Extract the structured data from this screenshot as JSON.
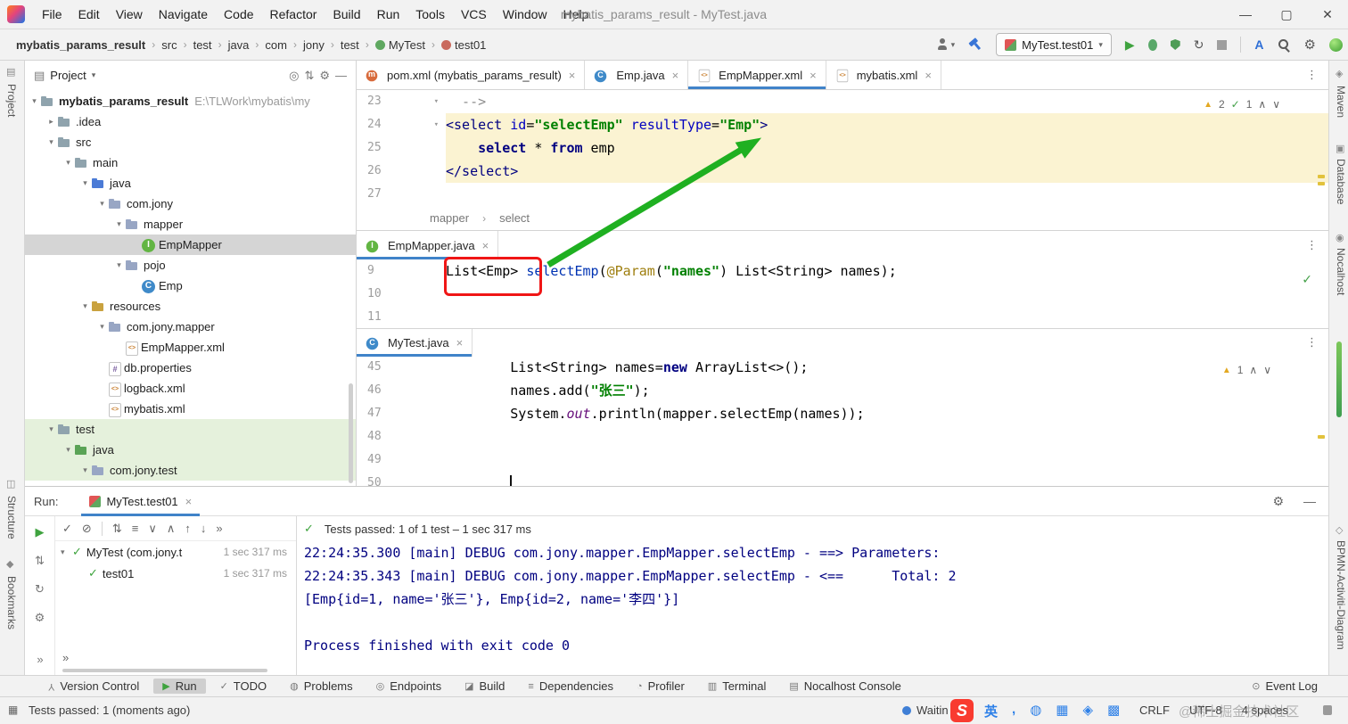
{
  "window": {
    "title": "mybatis_params_result - MyTest.java"
  },
  "menubar": [
    "File",
    "Edit",
    "View",
    "Navigate",
    "Code",
    "Refactor",
    "Build",
    "Run",
    "Tools",
    "VCS",
    "Window",
    "Help"
  ],
  "navbar": {
    "breadcrumbs": [
      {
        "label": "mybatis_params_result",
        "bold": true
      },
      {
        "label": "src"
      },
      {
        "label": "test"
      },
      {
        "label": "java"
      },
      {
        "label": "com"
      },
      {
        "label": "jony"
      },
      {
        "label": "test"
      },
      {
        "label": "MyTest",
        "icon": "test-class"
      },
      {
        "label": "test01",
        "icon": "test-method"
      }
    ],
    "run_config": "MyTest.test01"
  },
  "left_strip": {
    "items": [
      {
        "label": "Project"
      },
      {
        "label": "Structure"
      },
      {
        "label": "Bookmarks"
      }
    ]
  },
  "right_strip": {
    "items": [
      {
        "label": "Maven"
      },
      {
        "label": "Database"
      },
      {
        "label": "Nocalhost"
      },
      {
        "label": "BPMN-Activiti-Diagram"
      }
    ]
  },
  "project": {
    "title": "Project",
    "tree": [
      {
        "label": "mybatis_params_result",
        "hint": "E:\\TLWork\\mybatis\\my",
        "level": 0,
        "chev": "open",
        "icon": "folder",
        "bold": true
      },
      {
        "label": ".idea",
        "level": 1,
        "chev": "closed",
        "icon": "folder"
      },
      {
        "label": "src",
        "level": 1,
        "chev": "open",
        "icon": "folder"
      },
      {
        "label": "main",
        "level": 2,
        "chev": "open",
        "icon": "folder"
      },
      {
        "label": "java",
        "level": 3,
        "chev": "open",
        "icon": "folder-src"
      },
      {
        "label": "com.jony",
        "level": 4,
        "chev": "open",
        "icon": "package"
      },
      {
        "label": "mapper",
        "level": 5,
        "chev": "open",
        "icon": "package"
      },
      {
        "label": "EmpMapper",
        "level": 6,
        "icon": "interface",
        "selected": true
      },
      {
        "label": "pojo",
        "level": 5,
        "chev": "open",
        "icon": "package"
      },
      {
        "label": "Emp",
        "level": 6,
        "icon": "class"
      },
      {
        "label": "resources",
        "level": 3,
        "chev": "open",
        "icon": "folder-res"
      },
      {
        "label": "com.jony.mapper",
        "level": 4,
        "chev": "open",
        "icon": "package"
      },
      {
        "label": "EmpMapper.xml",
        "level": 5,
        "icon": "xml"
      },
      {
        "label": "db.properties",
        "level": 4,
        "icon": "props"
      },
      {
        "label": "logback.xml",
        "level": 4,
        "icon": "xml"
      },
      {
        "label": "mybatis.xml",
        "level": 4,
        "icon": "xml"
      },
      {
        "label": "test",
        "level": 1,
        "chev": "open",
        "icon": "folder",
        "green": true
      },
      {
        "label": "java",
        "level": 2,
        "chev": "open",
        "icon": "folder-testsrc",
        "green": true
      },
      {
        "label": "com.jony.test",
        "level": 3,
        "chev": "open",
        "icon": "package",
        "green": true
      }
    ]
  },
  "editor_tabs": [
    {
      "label": "pom.xml (mybatis_params_result)",
      "icon": "maven"
    },
    {
      "label": "Emp.java",
      "icon": "class"
    },
    {
      "label": "EmpMapper.xml",
      "icon": "xml",
      "selected": true
    },
    {
      "label": "mybatis.xml",
      "icon": "xml"
    }
  ],
  "xml_editor": {
    "inspections": {
      "warnings": "2",
      "ok": "1"
    },
    "breadcrumb": [
      "mapper",
      "select"
    ],
    "lines": [
      {
        "no": "23",
        "fold": true,
        "segs": [
          [
            "com",
            "  -->"
          ]
        ]
      },
      {
        "no": "24",
        "fold": true,
        "hl": true,
        "segs": [
          [
            "tag",
            "<select"
          ],
          [
            "attr",
            " id"
          ],
          [
            "pln",
            "="
          ],
          [
            "str",
            "\"selectEmp\""
          ],
          [
            "attr",
            " resultType"
          ],
          [
            "pln",
            "="
          ],
          [
            "str",
            "\"Emp\""
          ],
          [
            "tag",
            ">"
          ]
        ]
      },
      {
        "no": "25",
        "hl": true,
        "segs": [
          [
            "kw",
            "    select"
          ],
          [
            "pln",
            " * "
          ],
          [
            "kw",
            "from"
          ],
          [
            "pln",
            " emp"
          ]
        ]
      },
      {
        "no": "26",
        "hl": true,
        "segs": [
          [
            "tag",
            "</select>"
          ]
        ]
      },
      {
        "no": "27",
        "segs": []
      }
    ]
  },
  "mapper_panel": {
    "tab": "EmpMapper.java",
    "lines": [
      {
        "no": "9",
        "segs": [
          [
            "pln",
            "List<Emp> "
          ],
          [
            "meth",
            "selectEmp"
          ],
          [
            "pln",
            "("
          ],
          [
            "ann",
            "@Param"
          ],
          [
            "pln",
            "("
          ],
          [
            "str",
            "\"names\""
          ],
          [
            "pln",
            ") List<String> names);"
          ]
        ]
      },
      {
        "no": "10",
        "segs": []
      },
      {
        "no": "11",
        "segs": []
      }
    ]
  },
  "test_panel": {
    "tab": "MyTest.java",
    "inspections": {
      "warnings": "1"
    },
    "lines": [
      {
        "no": "45",
        "segs": [
          [
            "pln",
            "        List<String> names="
          ],
          [
            "kw",
            "new"
          ],
          [
            "pln",
            " ArrayList<>();"
          ]
        ]
      },
      {
        "no": "46",
        "segs": [
          [
            "pln",
            "        names.add("
          ],
          [
            "str",
            "\"张三\""
          ],
          [
            "pln",
            ");"
          ]
        ]
      },
      {
        "no": "47",
        "segs": [
          [
            "pln",
            "        System."
          ],
          [
            "fld",
            "out"
          ],
          [
            "pln",
            ".println(mapper.selectEmp(names));"
          ]
        ]
      },
      {
        "no": "48",
        "segs": []
      },
      {
        "no": "49",
        "segs": []
      },
      {
        "no": "50",
        "caret": true,
        "segs": [
          [
            "pln",
            "        "
          ]
        ]
      }
    ]
  },
  "run_panel": {
    "label": "Run:",
    "tab": "MyTest.test01",
    "status": "Tests passed: 1 of 1 test – 1 sec 317 ms",
    "left_icons": [
      "rerun",
      "filter",
      "refresh",
      "fix"
    ],
    "toolbar_icons": [
      "passed-filter",
      "ignored-filter",
      "divider",
      "sort-alpha",
      "sort-duration",
      "expand-all",
      "collapse-all",
      "previous",
      "next",
      "more"
    ],
    "tree": [
      {
        "label": "MyTest (com.jony.t",
        "time": "1 sec 317 ms",
        "chev": true
      },
      {
        "label": "test01",
        "time": "1 sec 317 ms",
        "indent": true
      }
    ],
    "console": [
      "22:24:35.300 [main] DEBUG com.jony.mapper.EmpMapper.selectEmp - ==> Parameters: ",
      "22:24:35.343 [main] DEBUG com.jony.mapper.EmpMapper.selectEmp - <==      Total: 2",
      "[Emp{id=1, name='张三'}, Emp{id=2, name='李四'}]",
      "",
      "Process finished with exit code 0"
    ]
  },
  "bottom_bar": {
    "items": [
      {
        "label": "Version Control",
        "icon": "branch"
      },
      {
        "label": "Run",
        "icon": "run",
        "selected": true
      },
      {
        "label": "TODO",
        "icon": "todo"
      },
      {
        "label": "Problems",
        "icon": "problems"
      },
      {
        "label": "Endpoints",
        "icon": "endpoints"
      },
      {
        "label": "Build",
        "icon": "build"
      },
      {
        "label": "Dependencies",
        "icon": "dependencies"
      },
      {
        "label": "Profiler",
        "icon": "profiler"
      },
      {
        "label": "Terminal",
        "icon": "terminal"
      },
      {
        "label": "Nocalhost Console",
        "icon": "nocalhost"
      }
    ],
    "right": {
      "label": "Event Log",
      "icon": "event-log"
    }
  },
  "status_bar": {
    "left": "Tests passed: 1 (moments ago)",
    "waiting": "Waitin",
    "ime_badge": "S",
    "ime_icons": [
      "英",
      ",",
      "◍",
      "▦",
      "◈",
      "▩"
    ],
    "items": [
      "CRLF",
      "UTF-8",
      "4 spaces"
    ],
    "watermark": "@稀土掘金技术社区"
  },
  "colors": {
    "accent_blue": "#4083c9",
    "selection_gray": "#d5d5d5",
    "vcs_green_row": "#e5f1dc",
    "injected_yellow": "#fbf3d2",
    "console_navy": "#000080",
    "arrow_green": "#1fb021",
    "highlight_red": "#f01616",
    "string_green": "#008000",
    "keyword_navy": "#000080"
  }
}
